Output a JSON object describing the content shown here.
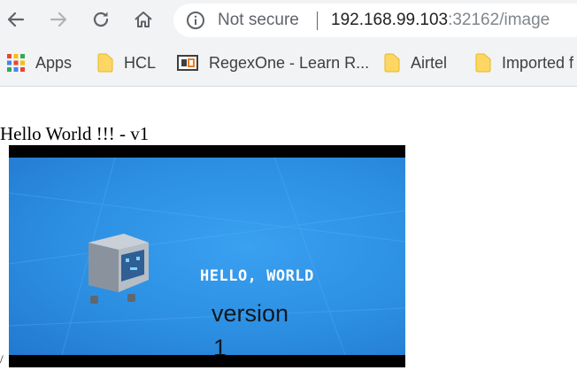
{
  "browser": {
    "security_label": "Not secure",
    "url_host": "192.168.99.103",
    "url_rest": ":32162/image",
    "bookmarks": [
      {
        "label": "Apps",
        "icon": "apps-grid-icon"
      },
      {
        "label": "HCL",
        "icon": "folder-icon"
      },
      {
        "label": "RegexOne - Learn R...",
        "icon": "regexone-favicon"
      },
      {
        "label": "Airtel",
        "icon": "folder-icon"
      },
      {
        "label": "Imported f",
        "icon": "folder-icon"
      }
    ],
    "folder_color": "#fdd663"
  },
  "page": {
    "heading": "Hello World !!! - v1",
    "image": {
      "hello_text": "HELLO, WORLD",
      "version_word": "version",
      "version_number": "1"
    },
    "stray_text": "/"
  }
}
